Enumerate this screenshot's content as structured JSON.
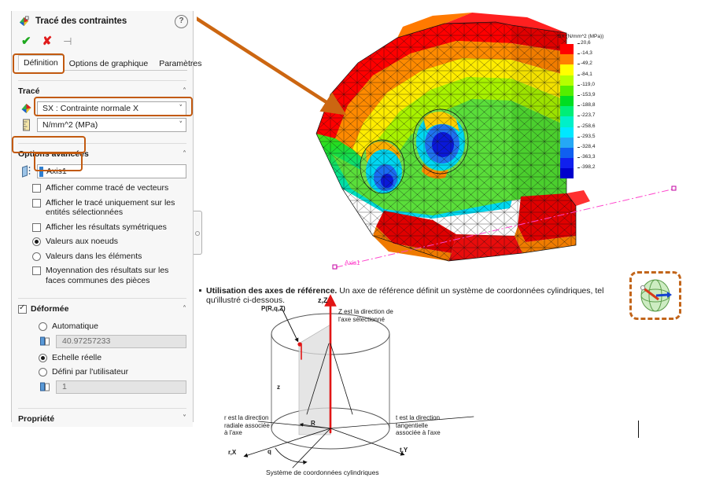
{
  "panel": {
    "title": "Tracé des contraintes",
    "help_icon": "help-icon",
    "actions": {
      "ok": "✔",
      "cancel": "✘",
      "pin": "⊣"
    },
    "tabs": [
      {
        "label": "Définition",
        "active": true
      },
      {
        "label": "Options de graphique",
        "active": false
      },
      {
        "label": "Paramètres",
        "active": false
      }
    ],
    "sections": {
      "trace": {
        "title": "Tracé",
        "collapse": "˄",
        "component_icon": "stress-plot-icon",
        "component_value": "SX : Contrainte normale X",
        "units_icon": "ruler-icon",
        "units_value": "N/mm^2 (MPa)",
        "dropdown_arrow": "˅"
      },
      "advanced": {
        "title": "Options avancées",
        "collapse": "˄",
        "axis_icon": "reference-axis-icon",
        "axis_value": "Axis1",
        "options": [
          {
            "type": "checkbox",
            "checked": false,
            "label": "Afficher comme tracé de vecteurs"
          },
          {
            "type": "checkbox",
            "checked": false,
            "label": "Afficher le tracé uniquement sur les entités sélectionnées"
          },
          {
            "type": "checkbox",
            "checked": false,
            "label": "Afficher les résultats symétriques"
          },
          {
            "type": "radio",
            "checked": true,
            "label": "Valeurs aux noeuds"
          },
          {
            "type": "radio",
            "checked": false,
            "label": "Valeurs dans les éléments"
          },
          {
            "type": "checkbox",
            "checked": false,
            "label": "Moyennation des résultats sur les faces communes des pièces"
          }
        ]
      },
      "deformee": {
        "title": "Déformée",
        "checked": true,
        "collapse": "˄",
        "auto_label": "Automatique",
        "auto_checked": false,
        "auto_value": "40.97257233",
        "real_label": "Echelle réelle",
        "real_checked": true,
        "user_label": "Défini par l'utilisateur",
        "user_checked": false,
        "user_value": "1",
        "scale_icon": "scale-factor-icon"
      },
      "propriete": {
        "title": "Propriété",
        "collapse": "˅"
      }
    }
  },
  "chart_data": {
    "type": "heatmap",
    "title": "SX (N/mm^2 (MPa))",
    "xlabel": "",
    "ylabel": "",
    "legend_position": "top-right",
    "grid": false,
    "categories": [],
    "values": [
      20.6,
      -14.3,
      -49.2,
      -84.1,
      -119.0,
      -153.9,
      -188.8,
      -223.7,
      -258.6,
      -293.5,
      -328.4,
      -363.3,
      -398.2
    ],
    "colors": [
      "#ff0000",
      "#ff8000",
      "#ffff00",
      "#b4ff00",
      "#55ee00",
      "#00dd22",
      "#00ee77",
      "#00f0c8",
      "#00e8ff",
      "#25a8f5",
      "#1060f0",
      "#1020ee",
      "#0000cc"
    ],
    "units": "N/mm^2 (MPa)",
    "model_axis_label": "Axis1"
  },
  "viewport": {
    "model_name": "stress-contour-model",
    "axis_label": "Axis1",
    "annotation_arrow": "orange-arrow-annotation"
  },
  "doc": {
    "bullet_bold": "Utilisation des axes de référence.",
    "bullet_rest": " Un axe de référence définit un système de coordonnées cylindriques, tel qu'illustré ci-dessous.",
    "figure": {
      "point_label": "P(R,q,Z)",
      "z_axis_label": "z,Z",
      "z_desc": "Z est la direction de\nl'axe sélectionné",
      "r_desc": "r est la direction\nradiale associée\nà l'axe",
      "t_desc": "t est la direction\ntangentielle\nassociée à l'axe",
      "r_axis_label": "r,X",
      "t_axis_label": "t,Y",
      "theta_label": "q",
      "radius_label": "R",
      "height_label": "z",
      "caption": "Système de coordonnées cylindriques"
    }
  },
  "ref_thumb": {
    "name": "reference-axis-thumbnail"
  }
}
